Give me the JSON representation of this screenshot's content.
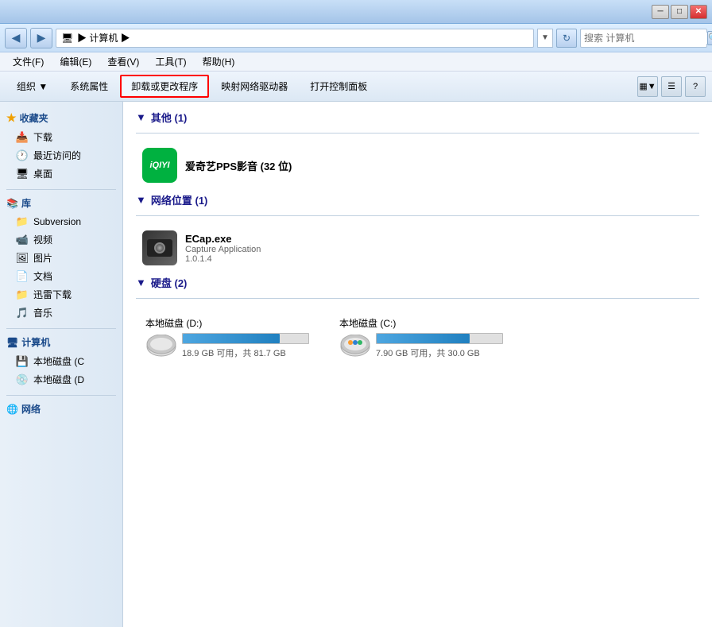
{
  "titlebar": {
    "minimize_label": "─",
    "maximize_label": "□",
    "close_label": "✕"
  },
  "addressbar": {
    "path": "计算机",
    "path_display": "  ▶  计算机  ▶",
    "search_placeholder": "搜索 计算机",
    "back_icon": "◀",
    "forward_icon": "▶",
    "refresh_icon": "↻",
    "dropdown_icon": "▼",
    "search_icon": "🔍"
  },
  "menubar": {
    "items": [
      {
        "label": "文件(F)"
      },
      {
        "label": "编辑(E)"
      },
      {
        "label": "查看(V)"
      },
      {
        "label": "工具(T)"
      },
      {
        "label": "帮助(H)"
      }
    ]
  },
  "toolbar": {
    "buttons": [
      {
        "label": "组织 ▼",
        "highlighted": false
      },
      {
        "label": "系统属性",
        "highlighted": false
      },
      {
        "label": "卸载或更改程序",
        "highlighted": true
      },
      {
        "label": "映射网络驱动器",
        "highlighted": false
      },
      {
        "label": "打开控制面板",
        "highlighted": false
      }
    ],
    "view_icon": "▦",
    "help_icon": "?"
  },
  "sidebar": {
    "favorites": {
      "header": "收藏夹",
      "items": [
        {
          "label": "下载",
          "icon": "📥"
        },
        {
          "label": "最近访问的",
          "icon": "🕐"
        },
        {
          "label": "桌面",
          "icon": "🖥"
        }
      ]
    },
    "library": {
      "header": "库",
      "items": [
        {
          "label": "Subversion",
          "icon": "📁"
        },
        {
          "label": "视频",
          "icon": "📹"
        },
        {
          "label": "图片",
          "icon": "🖼"
        },
        {
          "label": "文档",
          "icon": "📄"
        },
        {
          "label": "迅雷下载",
          "icon": "📁"
        },
        {
          "label": "音乐",
          "icon": "🎵"
        }
      ]
    },
    "computer": {
      "header": "计算机",
      "items": [
        {
          "label": "本地磁盘 (C",
          "icon": "💾"
        },
        {
          "label": "本地磁盘 (D",
          "icon": "💿"
        }
      ]
    },
    "network": {
      "header": "网络",
      "items": []
    }
  },
  "content": {
    "sections": [
      {
        "title": "其他 (1)",
        "items": [
          {
            "type": "app",
            "icon": "iqiyi",
            "name": "爱奇艺PPS影音 (32 位)",
            "sub": ""
          }
        ]
      },
      {
        "title": "网络位置 (1)",
        "items": [
          {
            "type": "camera",
            "name": "ECap.exe",
            "sub1": "Capture Application",
            "sub2": "1.0.1.4"
          }
        ]
      },
      {
        "title": "硬盘 (2)",
        "disks": [
          {
            "name": "本地磁盘 (D:)",
            "free": "18.9 GB 可用，共 81.7 GB",
            "percent": 77
          },
          {
            "name": "本地磁盘 (C:)",
            "free": "7.90 GB 可用，共 30.0 GB",
            "percent": 74
          }
        ]
      }
    ]
  }
}
